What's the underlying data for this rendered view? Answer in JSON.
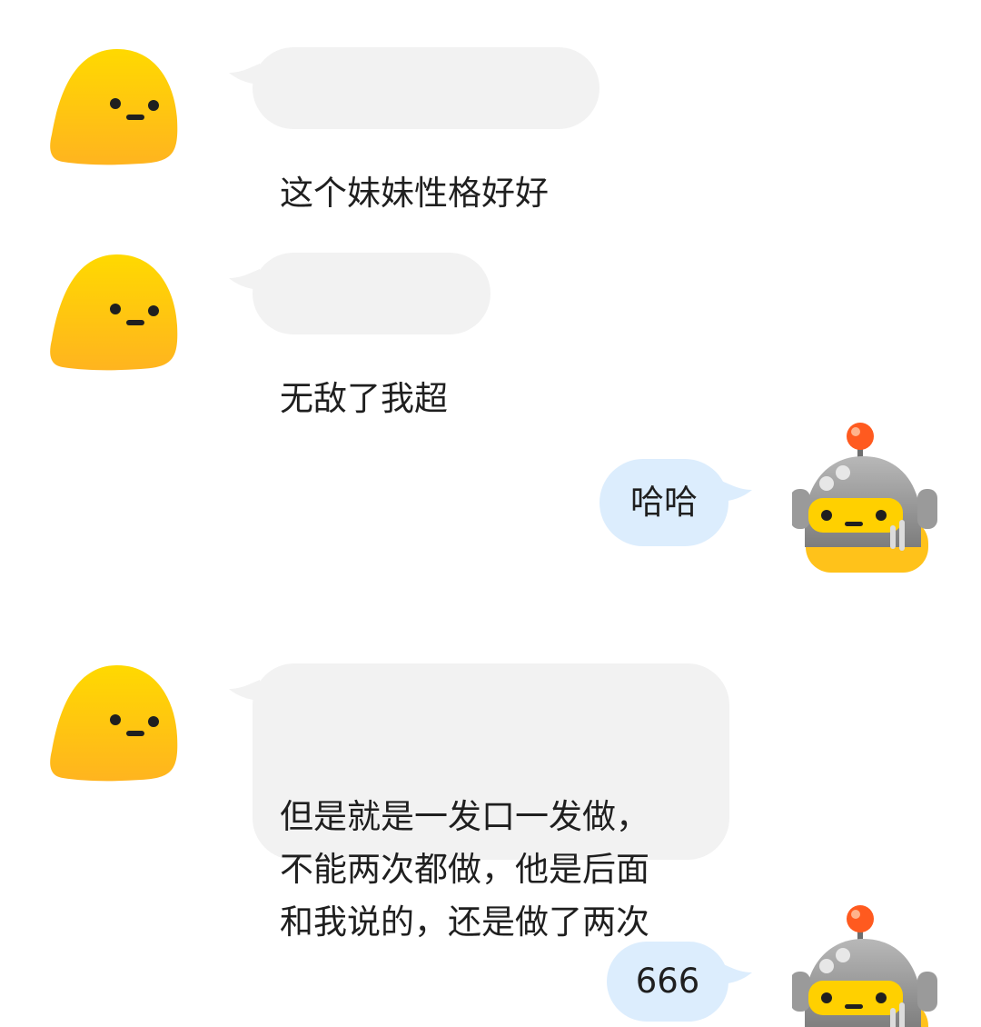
{
  "chat": {
    "messages": [
      {
        "sender": "incoming",
        "avatar_icon": "yellow-blob-avatar",
        "text": "这个妹妹性格好好"
      },
      {
        "sender": "incoming",
        "avatar_icon": "yellow-blob-avatar",
        "text": "无敌了我超"
      },
      {
        "sender": "outgoing",
        "avatar_icon": "robot-avatar",
        "text": "哈哈"
      },
      {
        "sender": "incoming",
        "avatar_icon": "yellow-blob-avatar",
        "text": "但是就是一发口一发做，\n不能两次都做，他是后面\n和我说的，还是做了两次"
      },
      {
        "sender": "outgoing",
        "avatar_icon": "robot-avatar",
        "text": "666"
      }
    ]
  },
  "colors": {
    "incoming_bubble": "#f2f2f2",
    "outgoing_bubble": "#dcedfd",
    "text": "#1f1f1f",
    "blob_yellow": "#ffd600",
    "robot_gray": "#9a9a9a",
    "robot_antenna": "#ff5a1f"
  }
}
